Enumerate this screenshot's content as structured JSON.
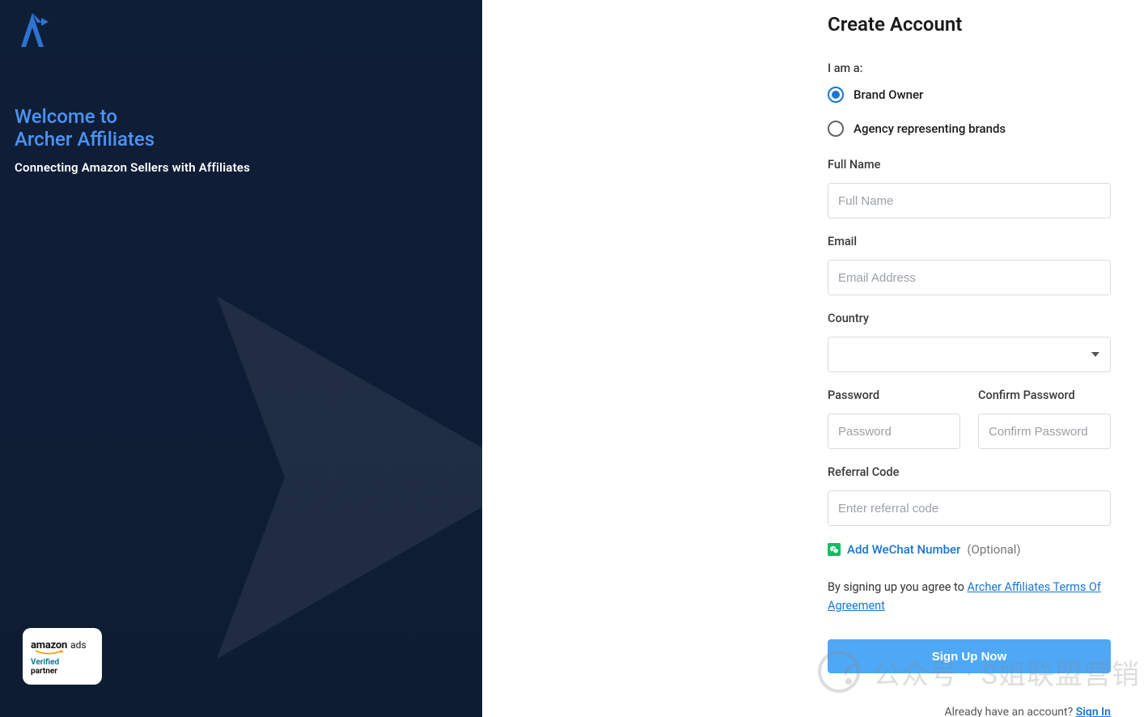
{
  "left": {
    "welcome_line1": "Welcome to",
    "welcome_line2": "Archer Affiliates",
    "tagline": "Connecting Amazon Sellers with Affiliates",
    "badge": {
      "amazon": "amazon",
      "ads": "ads",
      "verified": "Verified",
      "partner": "partner"
    }
  },
  "form": {
    "title": "Create Account",
    "iam_label": "I am a:",
    "radio_brand": "Brand Owner",
    "radio_agency": "Agency representing brands",
    "fullname_label": "Full Name",
    "fullname_placeholder": "Full Name",
    "email_label": "Email",
    "email_placeholder": "Email Address",
    "country_label": "Country",
    "password_label": "Password",
    "password_placeholder": "Password",
    "confirm_label": "Confirm Password",
    "confirm_placeholder": "Confirm Password",
    "referral_label": "Referral Code",
    "referral_placeholder": "Enter referral code",
    "wechat_link": "Add WeChat Number",
    "wechat_optional": "(Optional)",
    "terms_prefix": "By signing up you agree to ",
    "terms_link": "Archer Affiliates Terms Of Agreement",
    "signup_button": "Sign Up Now",
    "signin_prefix": "Already have an account? ",
    "signin_link": "Sign In"
  },
  "watermark": "公众号 · S姐联盟营销"
}
